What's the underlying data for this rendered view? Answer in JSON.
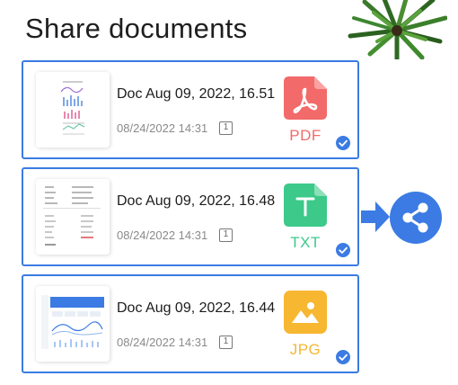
{
  "header": {
    "title": "Share documents"
  },
  "documents": [
    {
      "name": "Doc Aug 09, 2022, 16.51",
      "date": "08/24/2022 14:31",
      "pages": "1",
      "type": "PDF",
      "type_color": "#f26a6a",
      "icon": "pdf-file-icon",
      "selected": true
    },
    {
      "name": "Doc Aug 09, 2022, 16.48",
      "date": "08/24/2022 14:31",
      "pages": "1",
      "type": "TXT",
      "type_color": "#3cc98a",
      "icon": "txt-file-icon",
      "selected": true
    },
    {
      "name": "Doc Aug 09, 2022, 16.44",
      "date": "08/24/2022 14:31",
      "pages": "1",
      "type": "JPG",
      "type_color": "#f7b731",
      "icon": "jpg-file-icon",
      "selected": true
    }
  ],
  "colors": {
    "accent": "#3b7be3"
  },
  "icons": {
    "arrow": "arrow-right-icon",
    "share": "share-icon",
    "check": "checkmark-icon",
    "decoration": "plant-icon"
  }
}
